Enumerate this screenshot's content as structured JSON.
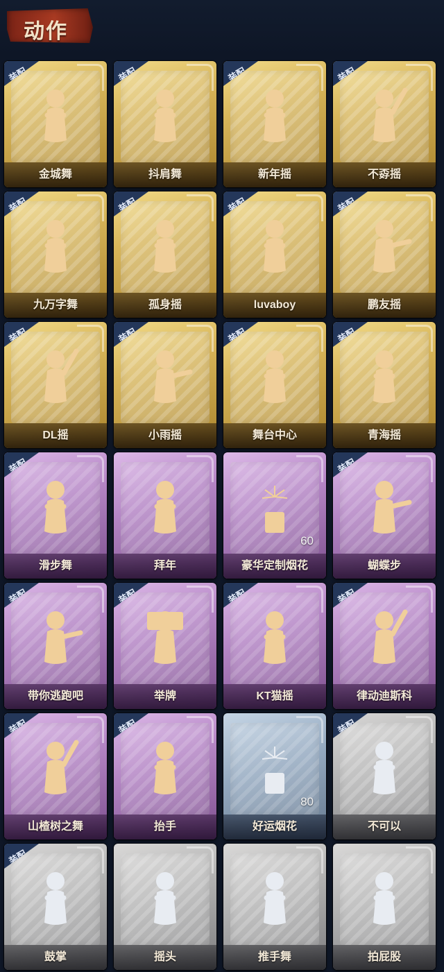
{
  "header": {
    "title": "动作"
  },
  "badge_text": "装配",
  "colors": {
    "gold_card": "#d8b65a",
    "purple_card": "#b586c6",
    "blue_card": "#93a8bf",
    "gray_card": "#b0b0b0",
    "figure_gold": "#f0cf9a",
    "badge_bg": "#24375a",
    "page_bg": "#0e1626"
  },
  "cards": [
    {
      "label": "金城舞",
      "tier": "gold",
      "equipped": true,
      "icon": "dancer-wave-icon",
      "count": ""
    },
    {
      "label": "抖肩舞",
      "tier": "gold",
      "equipped": true,
      "icon": "dancer-shoulder-shake-icon",
      "count": ""
    },
    {
      "label": "新年摇",
      "tier": "gold",
      "equipped": true,
      "icon": "dancer-new-year-icon",
      "count": ""
    },
    {
      "label": "不孬摇",
      "tier": "gold",
      "equipped": true,
      "icon": "dancer-arm-up-icon",
      "count": ""
    },
    {
      "label": "九万字舞",
      "tier": "gold",
      "equipped": true,
      "icon": "dancer-swirl-icon",
      "count": ""
    },
    {
      "label": "孤身摇",
      "tier": "gold",
      "equipped": true,
      "icon": "dancer-sway-icon",
      "count": ""
    },
    {
      "label": "luvaboy",
      "tier": "gold",
      "equipped": true,
      "icon": "dancer-cross-arm-icon",
      "count": ""
    },
    {
      "label": "鹏友摇",
      "tier": "gold",
      "equipped": true,
      "icon": "dancer-point-icon",
      "count": ""
    },
    {
      "label": "DL摇",
      "tier": "gold",
      "equipped": true,
      "icon": "dancer-raise-arm-icon",
      "count": ""
    },
    {
      "label": "小雨摇",
      "tier": "gold",
      "equipped": true,
      "icon": "dancer-rain-icon",
      "count": ""
    },
    {
      "label": "舞台中心",
      "tier": "gold",
      "equipped": true,
      "icon": "dancer-center-stage-icon",
      "count": ""
    },
    {
      "label": "青海摇",
      "tier": "gold",
      "equipped": true,
      "icon": "dancer-hug-icon",
      "count": ""
    },
    {
      "label": "滑步舞",
      "tier": "purple",
      "equipped": true,
      "icon": "dancer-slide-icon",
      "count": ""
    },
    {
      "label": "拜年",
      "tier": "purple",
      "equipped": false,
      "icon": "bow-greeting-icon",
      "count": ""
    },
    {
      "label": "豪华定制烟花",
      "tier": "purple",
      "equipped": false,
      "icon": "fireworks-box-icon",
      "count": "60"
    },
    {
      "label": "蝴蝶步",
      "tier": "purple",
      "equipped": true,
      "icon": "dancer-butterfly-icon",
      "count": ""
    },
    {
      "label": "带你逃跑吧",
      "tier": "purple",
      "equipped": true,
      "icon": "dancer-run-icon",
      "count": ""
    },
    {
      "label": "举牌",
      "tier": "purple",
      "equipped": true,
      "icon": "hold-sign-icon",
      "count": ""
    },
    {
      "label": "KT猫摇",
      "tier": "purple",
      "equipped": true,
      "icon": "dancer-cat-icon",
      "count": ""
    },
    {
      "label": "律动迪斯科",
      "tier": "purple",
      "equipped": true,
      "icon": "dancer-disco-icon",
      "count": ""
    },
    {
      "label": "山楂树之舞",
      "tier": "purple",
      "equipped": true,
      "icon": "dancer-hawthorn-icon",
      "count": ""
    },
    {
      "label": "抬手",
      "tier": "purple",
      "equipped": true,
      "icon": "raise-hand-icon",
      "count": ""
    },
    {
      "label": "好运烟花",
      "tier": "blue",
      "equipped": false,
      "icon": "firework-tube-icon",
      "count": "80"
    },
    {
      "label": "不可以",
      "tier": "gray",
      "equipped": true,
      "icon": "finger-no-icon",
      "count": ""
    },
    {
      "label": "鼓掌",
      "tier": "gray",
      "equipped": true,
      "icon": "clap-hands-icon",
      "count": ""
    },
    {
      "label": "摇头",
      "tier": "gray",
      "equipped": false,
      "icon": "shake-head-icon",
      "count": ""
    },
    {
      "label": "推手舞",
      "tier": "gray",
      "equipped": false,
      "icon": "push-hands-icon",
      "count": ""
    },
    {
      "label": "拍屁股",
      "tier": "gray",
      "equipped": false,
      "icon": "pat-butt-icon",
      "count": ""
    }
  ]
}
